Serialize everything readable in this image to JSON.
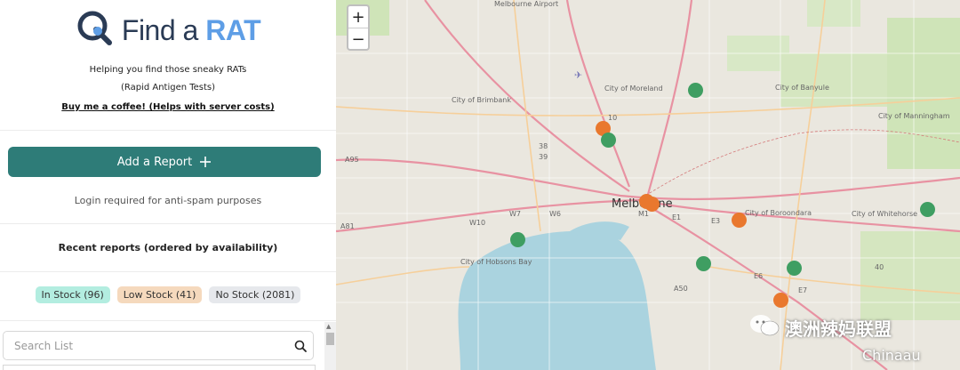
{
  "app": {
    "logo_main": "Find a ",
    "logo_accent": "RAT",
    "tagline_1": "Helping you find those sneaky RATs",
    "tagline_2": "(Rapid Antigen Tests)",
    "coffee_link": "Buy me a coffee! (Helps with server costs)"
  },
  "actions": {
    "add_report": "Add a Report",
    "login_note": "Login required for anti-spam purposes"
  },
  "reports": {
    "heading": "Recent reports (ordered by availability)",
    "filters": [
      {
        "label": "In Stock (96)"
      },
      {
        "label": "Low Stock (41)"
      },
      {
        "label": "No Stock (2081)"
      }
    ]
  },
  "search": {
    "placeholder": "Search List"
  },
  "map": {
    "zoom_in": "+",
    "zoom_out": "−",
    "labels": {
      "city_centre": "Melbourne",
      "moreland": "City of Moreland",
      "banyule": "City of Banyule",
      "brimbank": "City of Brimbank",
      "boroondara": "City of Boroondara",
      "whitehorse": "City of Whitehorse",
      "hobsons_bay": "City of Hobsons Bay",
      "manningham": "City of Manningham",
      "airport": "Melbourne Airport"
    },
    "route_labels": [
      "A95",
      "A81",
      "A50",
      "38",
      "39",
      "W10",
      "W7",
      "W6",
      "M1",
      "E1",
      "E3",
      "E6",
      "E7",
      "10",
      "40"
    ],
    "watermark_cn": "澳洲辣妈联盟",
    "watermark_en": "Chinaau"
  },
  "colors": {
    "primary_button": "#2e7c78",
    "in_stock": "#3f9e62",
    "low_stock": "#e9782e",
    "water": "#aad3df",
    "logo_text": "#2a3b55",
    "logo_accent": "#5e9ee6"
  }
}
